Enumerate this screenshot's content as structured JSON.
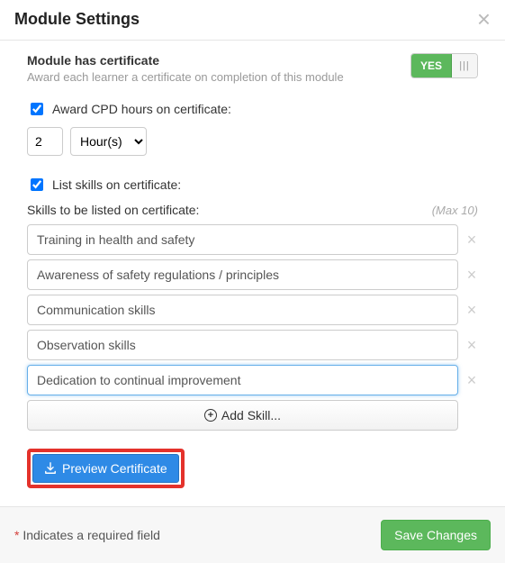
{
  "header": {
    "title": "Module Settings"
  },
  "certificate": {
    "label": "Module has certificate",
    "desc": "Award each learner a certificate on completion of this module",
    "toggle_yes": "YES"
  },
  "cpd": {
    "checkbox_label": "Award CPD hours on certificate:",
    "value": "2",
    "unit": "Hour(s)"
  },
  "skills": {
    "checkbox_label": "List skills on certificate:",
    "header": "Skills to be listed on certificate:",
    "max": "(Max 10)",
    "items": [
      "Training in health and safety",
      "Awareness of safety regulations / principles",
      "Communication skills",
      "Observation skills",
      "Dedication to continual improvement"
    ],
    "add_label": "Add Skill..."
  },
  "preview": {
    "label": "Preview Certificate"
  },
  "footer": {
    "required_note": "Indicates a required field",
    "save_label": "Save Changes"
  }
}
